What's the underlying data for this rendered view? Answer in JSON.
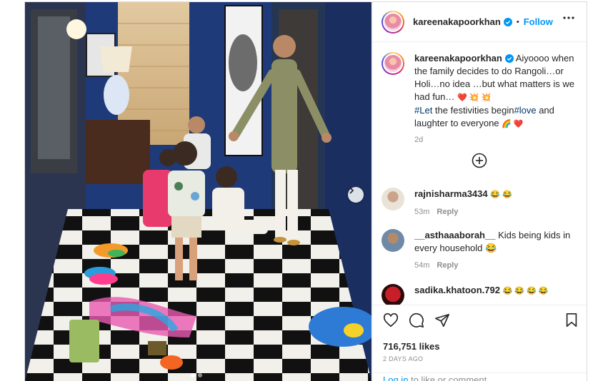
{
  "post": {
    "username": "kareenakapoorkhan",
    "follow_label": "Follow",
    "header_dot": "•",
    "caption": {
      "text_1": "Aiyoooo when the family decides to do Rangoli…or Holi…no idea …but what matters is we had fun…",
      "emoji_1": "❤️ 💥 💥",
      "hashtag_let": "#Let",
      "text_2": " the festivities begin",
      "hashtag_love": "#love",
      "text_3": " and laughter to everyone ",
      "emoji_2": "🌈 ❤️",
      "time": "2d"
    },
    "photo": {
      "active_slide": 1,
      "slide_count": 2
    },
    "colors": {
      "accent": "#0095f6",
      "wall": "#1f3a78",
      "hashtag": "#00376b"
    }
  },
  "comments": [
    {
      "user": "rajnisharma3434",
      "text": "😂 😂",
      "time": "53m",
      "reply": "Reply"
    },
    {
      "user": "__asthaaaborah__",
      "text": "Kids being kids in every household 😂",
      "time": "54m",
      "reply": "Reply"
    },
    {
      "user": "sadika.khatoon.792",
      "text": "😂 😂 😂 😂",
      "time": "",
      "reply": ""
    }
  ],
  "engagement": {
    "likes": "716,751 likes",
    "ago": "2 DAYS AGO",
    "login_link": "Log in",
    "login_rest": " to like or comment."
  },
  "icons": [
    "verified-icon",
    "more-options-icon",
    "plus-circle-icon",
    "heart-icon",
    "comment-icon",
    "share-icon",
    "bookmark-icon",
    "chevron-right-icon"
  ]
}
